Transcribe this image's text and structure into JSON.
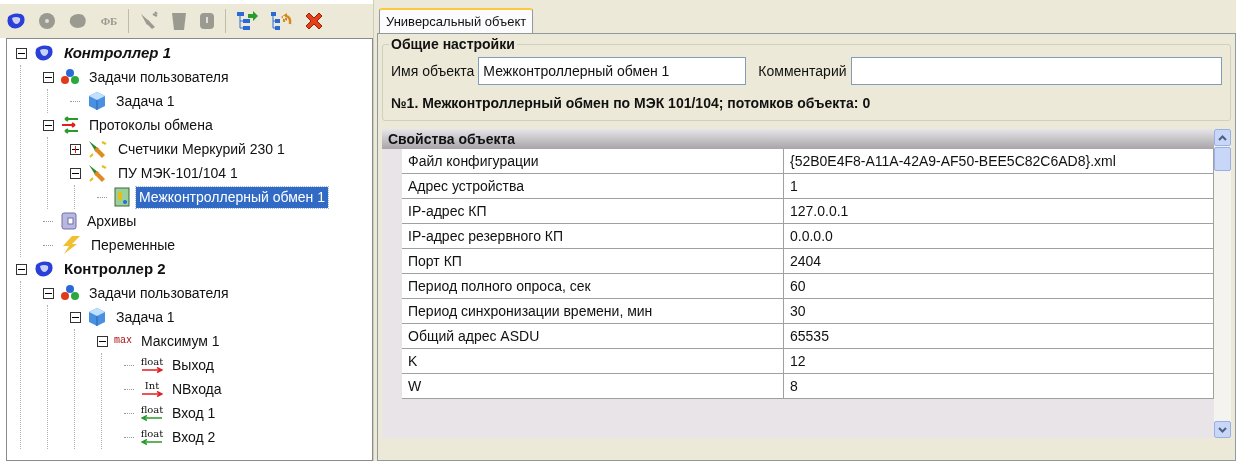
{
  "toolbar": [
    {
      "kind": "controller",
      "disabled": false
    },
    {
      "kind": "circle",
      "disabled": true
    },
    {
      "kind": "blob",
      "disabled": true
    },
    {
      "kind": "text",
      "label": "ФБ",
      "disabled": true
    },
    {
      "kind": "separator"
    },
    {
      "kind": "plug",
      "disabled": true
    },
    {
      "kind": "bin",
      "disabled": true
    },
    {
      "kind": "shield",
      "disabled": true
    },
    {
      "kind": "separator"
    },
    {
      "kind": "tree-in",
      "disabled": false
    },
    {
      "kind": "tree-out",
      "disabled": false
    },
    {
      "kind": "delete",
      "disabled": false
    }
  ],
  "tree": [
    {
      "label": "Контроллер 1",
      "kind": "controller",
      "current": true,
      "expanded": true,
      "selected": false,
      "children": [
        {
          "label": "Задачи пользователя",
          "kind": "tasks",
          "expanded": true,
          "selected": false,
          "children": [
            {
              "label": "Задача 1",
              "kind": "task",
              "selected": false
            }
          ]
        },
        {
          "label": "Протоколы обмена",
          "kind": "protocols",
          "expanded": true,
          "selected": false,
          "children": [
            {
              "label": "Счетчики Меркурий 230 1",
              "kind": "plug",
              "expanded": false,
              "selected": false
            },
            {
              "label": "ПУ МЭК-101/104 1",
              "kind": "plug",
              "expanded": true,
              "selected": false,
              "children": [
                {
                  "label": "Межконтроллерный обмен 1",
                  "kind": "exchange",
                  "selected": true
                }
              ]
            }
          ]
        },
        {
          "label": "Архивы",
          "kind": "archive",
          "selected": false
        },
        {
          "label": "Переменные",
          "kind": "variables",
          "selected": false
        }
      ]
    },
    {
      "label": "Контроллер 2",
      "kind": "controller",
      "current": false,
      "expanded": true,
      "selected": false,
      "children": [
        {
          "label": "Задачи пользователя",
          "kind": "tasks",
          "expanded": true,
          "selected": false,
          "children": [
            {
              "label": "Задача 1",
              "kind": "task",
              "expanded": true,
              "selected": false,
              "children": [
                {
                  "label": "Максимум 1",
                  "kind": "function",
                  "badge": "max",
                  "expanded": true,
                  "selected": false,
                  "children": [
                    {
                      "label": "Выход",
                      "kind": "output",
                      "badge": "float",
                      "selected": false
                    },
                    {
                      "label": "NВхода",
                      "kind": "output",
                      "badge": "Int",
                      "selected": false
                    },
                    {
                      "label": "Вход 1",
                      "kind": "input",
                      "badge": "float",
                      "selected": false
                    },
                    {
                      "label": "Вход 2",
                      "kind": "input",
                      "badge": "float",
                      "selected": false
                    }
                  ]
                }
              ]
            }
          ]
        }
      ]
    }
  ],
  "tabs": [
    {
      "label": "Универсальный объект",
      "selected": true
    }
  ],
  "general": {
    "title": "Общие настройки",
    "name_label": "Имя объекта",
    "name_value": "Межконтроллерный обмен 1",
    "comment_label": "Комментарий",
    "summary": "№1. Межконтроллерный обмен по МЭК 101/104; потомков объекта: 0"
  },
  "properties": {
    "title": "Свойства объекта",
    "rows": [
      {
        "name": "Файл конфигурации",
        "value": "{52B0E4F8-A11A-42A9-AF50-BEE5C82C6AD8}.xml"
      },
      {
        "name": "Адрес устройства",
        "value": "1"
      },
      {
        "name": "IP-адрес КП",
        "value": "127.0.0.1"
      },
      {
        "name": "IP-адрес резервного КП",
        "value": "0.0.0.0"
      },
      {
        "name": "Порт КП",
        "value": "2404"
      },
      {
        "name": "Период полного опроса, сек",
        "value": "60"
      },
      {
        "name": "Период синхронизации времени, мин",
        "value": "30"
      },
      {
        "name": "Общий адрес ASDU",
        "value": "65535"
      },
      {
        "name": "K",
        "value": "12"
      },
      {
        "name": "W",
        "value": "8"
      }
    ]
  }
}
